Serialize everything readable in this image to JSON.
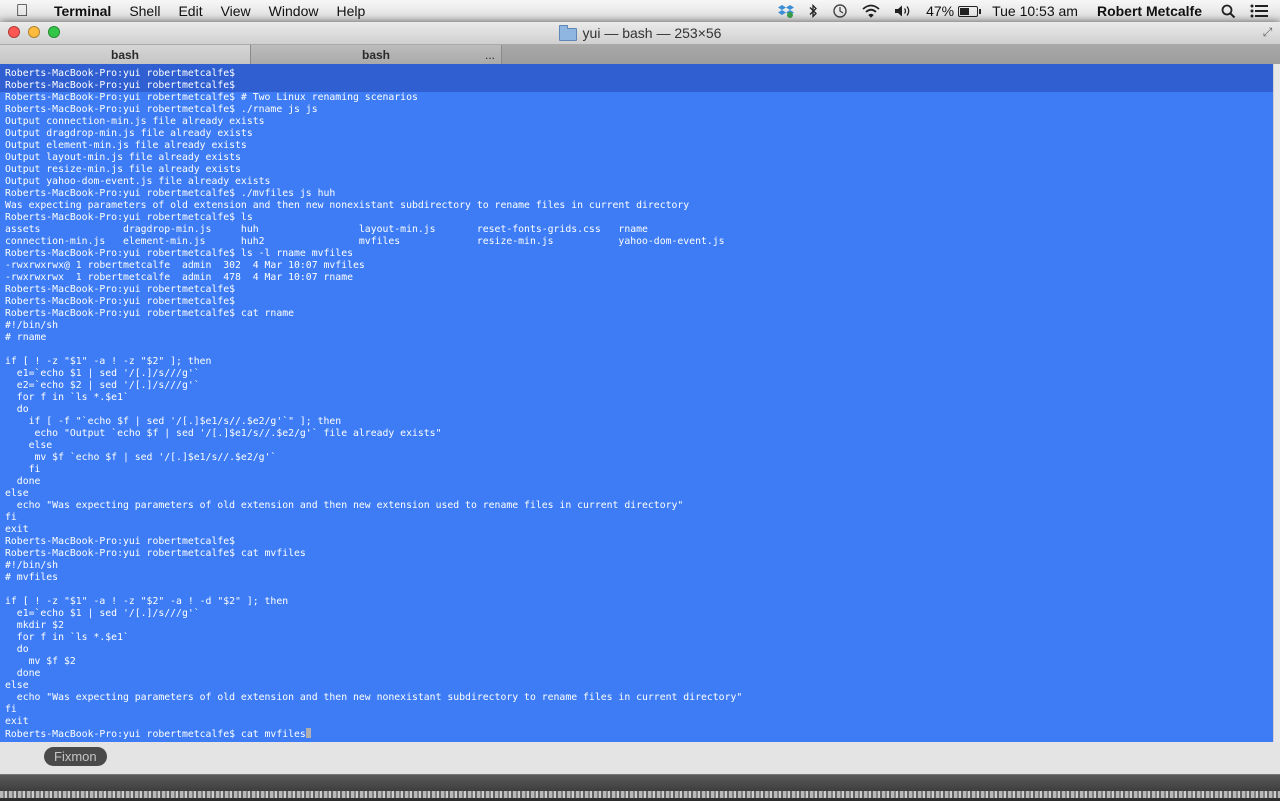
{
  "menubar": {
    "app": "Terminal",
    "items": [
      "Shell",
      "Edit",
      "View",
      "Window",
      "Help"
    ],
    "battery": "47%",
    "battery_level": 0.47,
    "clock": "Tue 10:53 am",
    "user": "Robert Metcalfe"
  },
  "window": {
    "title": "yui — bash — 253×56",
    "tabs": [
      {
        "label": "bash",
        "active": true
      },
      {
        "label": "bash",
        "active": false,
        "more": "..."
      }
    ]
  },
  "terminal": {
    "lines": [
      "Roberts-MacBook-Pro:yui robertmetcalfe$",
      "Roberts-MacBook-Pro:yui robertmetcalfe$",
      "Roberts-MacBook-Pro:yui robertmetcalfe$ # Two Linux renaming scenarios",
      "Roberts-MacBook-Pro:yui robertmetcalfe$ ./rname js js",
      "Output connection-min.js file already exists",
      "Output dragdrop-min.js file already exists",
      "Output element-min.js file already exists",
      "Output layout-min.js file already exists",
      "Output resize-min.js file already exists",
      "Output yahoo-dom-event.js file already exists",
      "Roberts-MacBook-Pro:yui robertmetcalfe$ ./mvfiles js huh",
      "Was expecting parameters of old extension and then new nonexistant subdirectory to rename files in current directory",
      "Roberts-MacBook-Pro:yui robertmetcalfe$ ls",
      "assets              dragdrop-min.js     huh                 layout-min.js       reset-fonts-grids.css   rname",
      "connection-min.js   element-min.js      huh2                mvfiles             resize-min.js           yahoo-dom-event.js",
      "Roberts-MacBook-Pro:yui robertmetcalfe$ ls -l rname mvfiles",
      "-rwxrwxrwx@ 1 robertmetcalfe  admin  302  4 Mar 10:07 mvfiles",
      "-rwxrwxrwx  1 robertmetcalfe  admin  478  4 Mar 10:07 rname",
      "Roberts-MacBook-Pro:yui robertmetcalfe$",
      "Roberts-MacBook-Pro:yui robertmetcalfe$",
      "Roberts-MacBook-Pro:yui robertmetcalfe$ cat rname",
      "#!/bin/sh",
      "# rname",
      "",
      "if [ ! -z \"$1\" -a ! -z \"$2\" ]; then",
      "  e1=`echo $1 | sed '/[.]/s///g'`",
      "  e2=`echo $2 | sed '/[.]/s///g'`",
      "  for f in `ls *.$e1`",
      "  do",
      "    if [ -f \"`echo $f | sed '/[.]$e1/s//.$e2/g'`\" ]; then",
      "     echo \"Output `echo $f | sed '/[.]$e1/s//.$e2/g'` file already exists\"",
      "    else",
      "     mv $f `echo $f | sed '/[.]$e1/s//.$e2/g'`",
      "    fi",
      "  done",
      "else",
      "  echo \"Was expecting parameters of old extension and then new extension used to rename files in current directory\"",
      "fi",
      "exit",
      "Roberts-MacBook-Pro:yui robertmetcalfe$",
      "Roberts-MacBook-Pro:yui robertmetcalfe$ cat mvfiles",
      "#!/bin/sh",
      "# mvfiles",
      "",
      "if [ ! -z \"$1\" -a ! -z \"$2\" -a ! -d \"$2\" ]; then",
      "  e1=`echo $1 | sed '/[.]/s///g'`",
      "  mkdir $2",
      "  for f in `ls *.$e1`",
      "  do",
      "    mv $f $2",
      "  done",
      "else",
      "  echo \"Was expecting parameters of old extension and then new nonexistant subdirectory to rename files in current directory\"",
      "fi",
      "exit",
      "Roberts-MacBook-Pro:yui robertmetcalfe$ cat mvfiles"
    ]
  },
  "dock": {
    "label": "Fixmon"
  }
}
